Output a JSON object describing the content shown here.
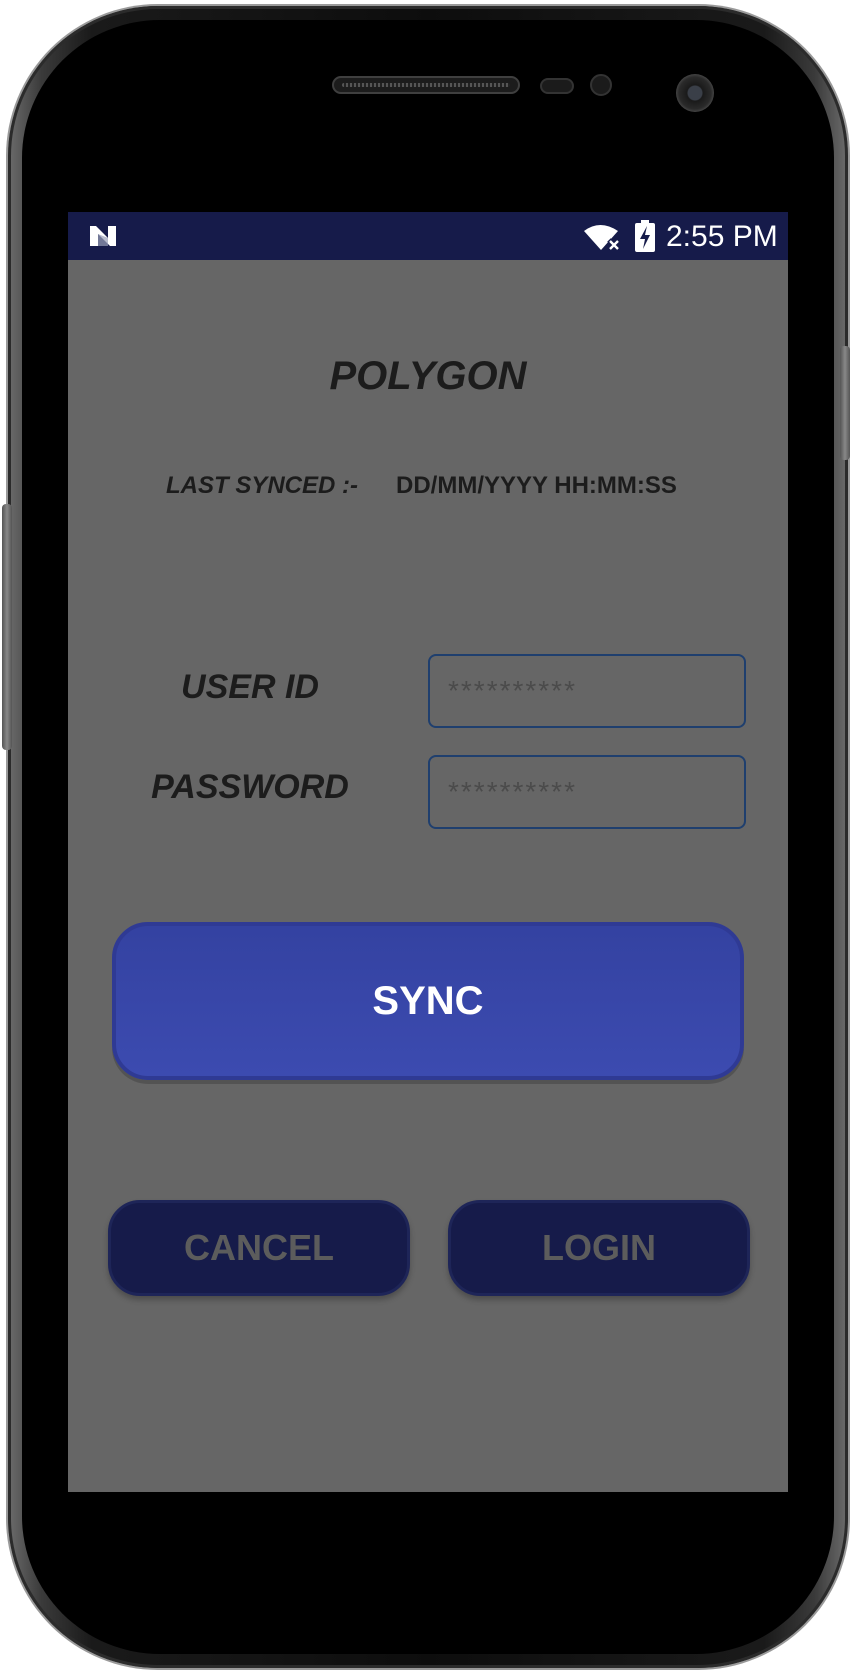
{
  "status_bar": {
    "time": "2:55 PM",
    "notification_icon": "n-icon",
    "wifi_icon": "wifi-off-icon",
    "battery_icon": "battery-charging-icon",
    "background_color": "#161b4a"
  },
  "app": {
    "title": "POLYGON",
    "last_synced_label": "LAST SYNCED :-",
    "last_synced_value": "DD/MM/YYYY HH:MM:SS",
    "background_color": "#666666"
  },
  "form": {
    "user_id_label": "USER ID",
    "user_id_placeholder": "**********",
    "password_label": "PASSWORD",
    "password_placeholder": "**********"
  },
  "buttons": {
    "sync_label": "SYNC",
    "sync_color": "#3a48ad",
    "cancel_label": "CANCEL",
    "login_label": "LOGIN",
    "secondary_color": "#161b4a"
  }
}
